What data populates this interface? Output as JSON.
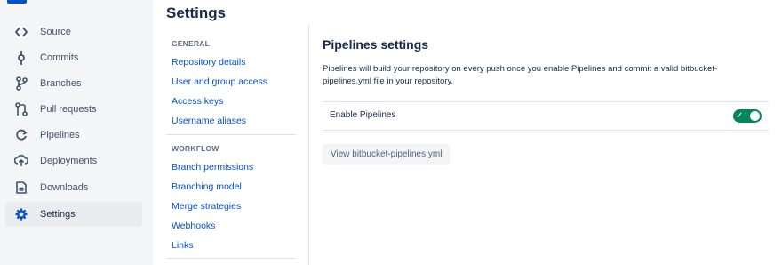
{
  "sidebar": {
    "items": [
      {
        "label": "Source",
        "icon": "code-icon"
      },
      {
        "label": "Commits",
        "icon": "commit-icon"
      },
      {
        "label": "Branches",
        "icon": "branch-icon"
      },
      {
        "label": "Pull requests",
        "icon": "pull-request-icon"
      },
      {
        "label": "Pipelines",
        "icon": "pipelines-icon"
      },
      {
        "label": "Deployments",
        "icon": "deployments-icon"
      },
      {
        "label": "Downloads",
        "icon": "downloads-icon"
      },
      {
        "label": "Settings",
        "icon": "gear-icon",
        "active": true
      }
    ]
  },
  "page": {
    "title": "Settings"
  },
  "settings_nav": {
    "general": {
      "heading": "GENERAL",
      "links": [
        "Repository details",
        "User and group access",
        "Access keys",
        "Username aliases"
      ]
    },
    "workflow": {
      "heading": "WORKFLOW",
      "links": [
        "Branch permissions",
        "Branching model",
        "Merge strategies",
        "Webhooks",
        "Links"
      ]
    }
  },
  "main": {
    "title": "Pipelines settings",
    "description": "Pipelines will build your repository on every push once you enable Pipelines and commit a valid bitbucket-pipelines.yml file in your repository.",
    "enable_label": "Enable Pipelines",
    "enabled": true,
    "view_button": "View bitbucket-pipelines.yml"
  },
  "colors": {
    "accent": "#0052cc",
    "toggle_on": "#00875a",
    "sidebar_bg": "#f4f5f7"
  }
}
